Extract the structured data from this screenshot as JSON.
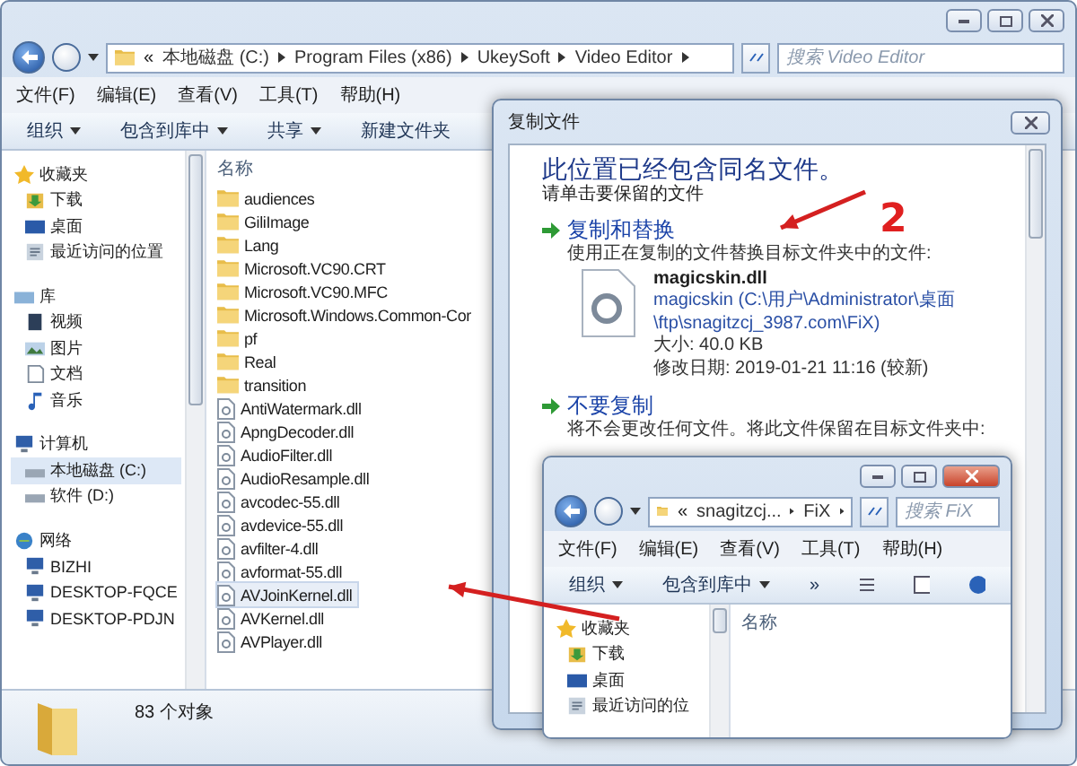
{
  "explorer": {
    "address_overflow": "«",
    "address": [
      "本地磁盘 (C:)",
      "Program Files (x86)",
      "UkeySoft",
      "Video Editor"
    ],
    "search": {
      "placeholder": "搜索 Video Editor"
    },
    "menu": [
      "文件(F)",
      "编辑(E)",
      "查看(V)",
      "工具(T)",
      "帮助(H)"
    ],
    "toolbar": [
      {
        "label": "组织",
        "dropdown": true
      },
      {
        "label": "包含到库中",
        "dropdown": true
      },
      {
        "label": "共享",
        "dropdown": true
      },
      {
        "label": "新建文件夹",
        "dropdown": false
      }
    ],
    "nav": [
      {
        "label": "收藏夹",
        "items": [
          {
            "label": "下载",
            "selected": false
          },
          {
            "label": "桌面",
            "selected": false
          },
          {
            "label": "最近访问的位置",
            "selected": false
          }
        ]
      },
      {
        "label": "库",
        "items": [
          {
            "label": "视频",
            "selected": false
          },
          {
            "label": "图片",
            "selected": false
          },
          {
            "label": "文档",
            "selected": false
          },
          {
            "label": "音乐",
            "selected": false
          }
        ]
      },
      {
        "label": "计算机",
        "items": [
          {
            "label": "本地磁盘 (C:)",
            "selected": true
          },
          {
            "label": "软件 (D:)",
            "selected": false
          }
        ]
      },
      {
        "label": "网络",
        "items": [
          {
            "label": "BIZHI",
            "selected": false
          },
          {
            "label": "DESKTOP-FQCE",
            "selected": false
          },
          {
            "label": "DESKTOP-PDJN",
            "selected": false
          }
        ]
      }
    ],
    "column_header": "名称",
    "files": [
      {
        "name": "audiences",
        "kind": "folder",
        "selected": false
      },
      {
        "name": "GiliImage",
        "kind": "folder",
        "selected": false
      },
      {
        "name": "Lang",
        "kind": "folder",
        "selected": false
      },
      {
        "name": "Microsoft.VC90.CRT",
        "kind": "folder",
        "selected": false
      },
      {
        "name": "Microsoft.VC90.MFC",
        "kind": "folder",
        "selected": false
      },
      {
        "name": "Microsoft.Windows.Common-Cor",
        "kind": "folder",
        "selected": false
      },
      {
        "name": "pf",
        "kind": "folder",
        "selected": false
      },
      {
        "name": "Real",
        "kind": "folder",
        "selected": false
      },
      {
        "name": "transition",
        "kind": "folder",
        "selected": false
      },
      {
        "name": "AntiWatermark.dll",
        "kind": "file",
        "selected": false
      },
      {
        "name": "ApngDecoder.dll",
        "kind": "file",
        "selected": false
      },
      {
        "name": "AudioFilter.dll",
        "kind": "file",
        "selected": false
      },
      {
        "name": "AudioResample.dll",
        "kind": "file",
        "selected": false
      },
      {
        "name": "avcodec-55.dll",
        "kind": "file",
        "selected": false
      },
      {
        "name": "avdevice-55.dll",
        "kind": "file",
        "selected": false
      },
      {
        "name": "avfilter-4.dll",
        "kind": "file",
        "selected": false
      },
      {
        "name": "avformat-55.dll",
        "kind": "file",
        "selected": false
      },
      {
        "name": "AVJoinKernel.dll",
        "kind": "file",
        "selected": true
      },
      {
        "name": "AVKernel.dll",
        "kind": "file",
        "selected": false
      },
      {
        "name": "AVPlayer.dll",
        "kind": "file",
        "selected": false
      }
    ],
    "status": "83 个对象"
  },
  "dialog": {
    "title": "复制文件",
    "heading": "此位置已经包含同名文件。",
    "subheading": "请单击要保留的文件",
    "options": [
      {
        "title": "复制和替换",
        "description": "使用正在复制的文件替换目标文件夹中的文件:"
      },
      {
        "title": "不要复制",
        "description": "将不会更改任何文件。将此文件保留在目标文件夹中:"
      }
    ],
    "file": {
      "name": "magicskin.dll",
      "details": [
        "magicskin (C:\\用户\\Administrator\\桌面",
        "\\ftp\\snagitzcj_3987.com\\FiX)",
        "大小: 40.0 KB",
        "修改日期: 2019-01-21 11:16 (较新)"
      ]
    }
  },
  "inner_window": {
    "address_overflow": "«",
    "address": [
      "snagitzcj...",
      "FiX"
    ],
    "search": {
      "placeholder": "搜索 FiX"
    },
    "menu": [
      "文件(F)",
      "编辑(E)",
      "查看(V)",
      "工具(T)",
      "帮助(H)"
    ],
    "toolbar": [
      {
        "label": "组织",
        "dropdown": true
      },
      {
        "label": "包含到库中",
        "dropdown": true
      },
      {
        "label": "»",
        "dropdown": false
      }
    ],
    "nav": [
      {
        "label": "收藏夹",
        "items": [
          {
            "label": "下载",
            "selected": false
          },
          {
            "label": "桌面",
            "selected": false
          },
          {
            "label": "最近访问的位",
            "selected": false
          }
        ]
      }
    ],
    "column_header": "名称"
  },
  "annotations": [
    {
      "text": "2"
    }
  ]
}
